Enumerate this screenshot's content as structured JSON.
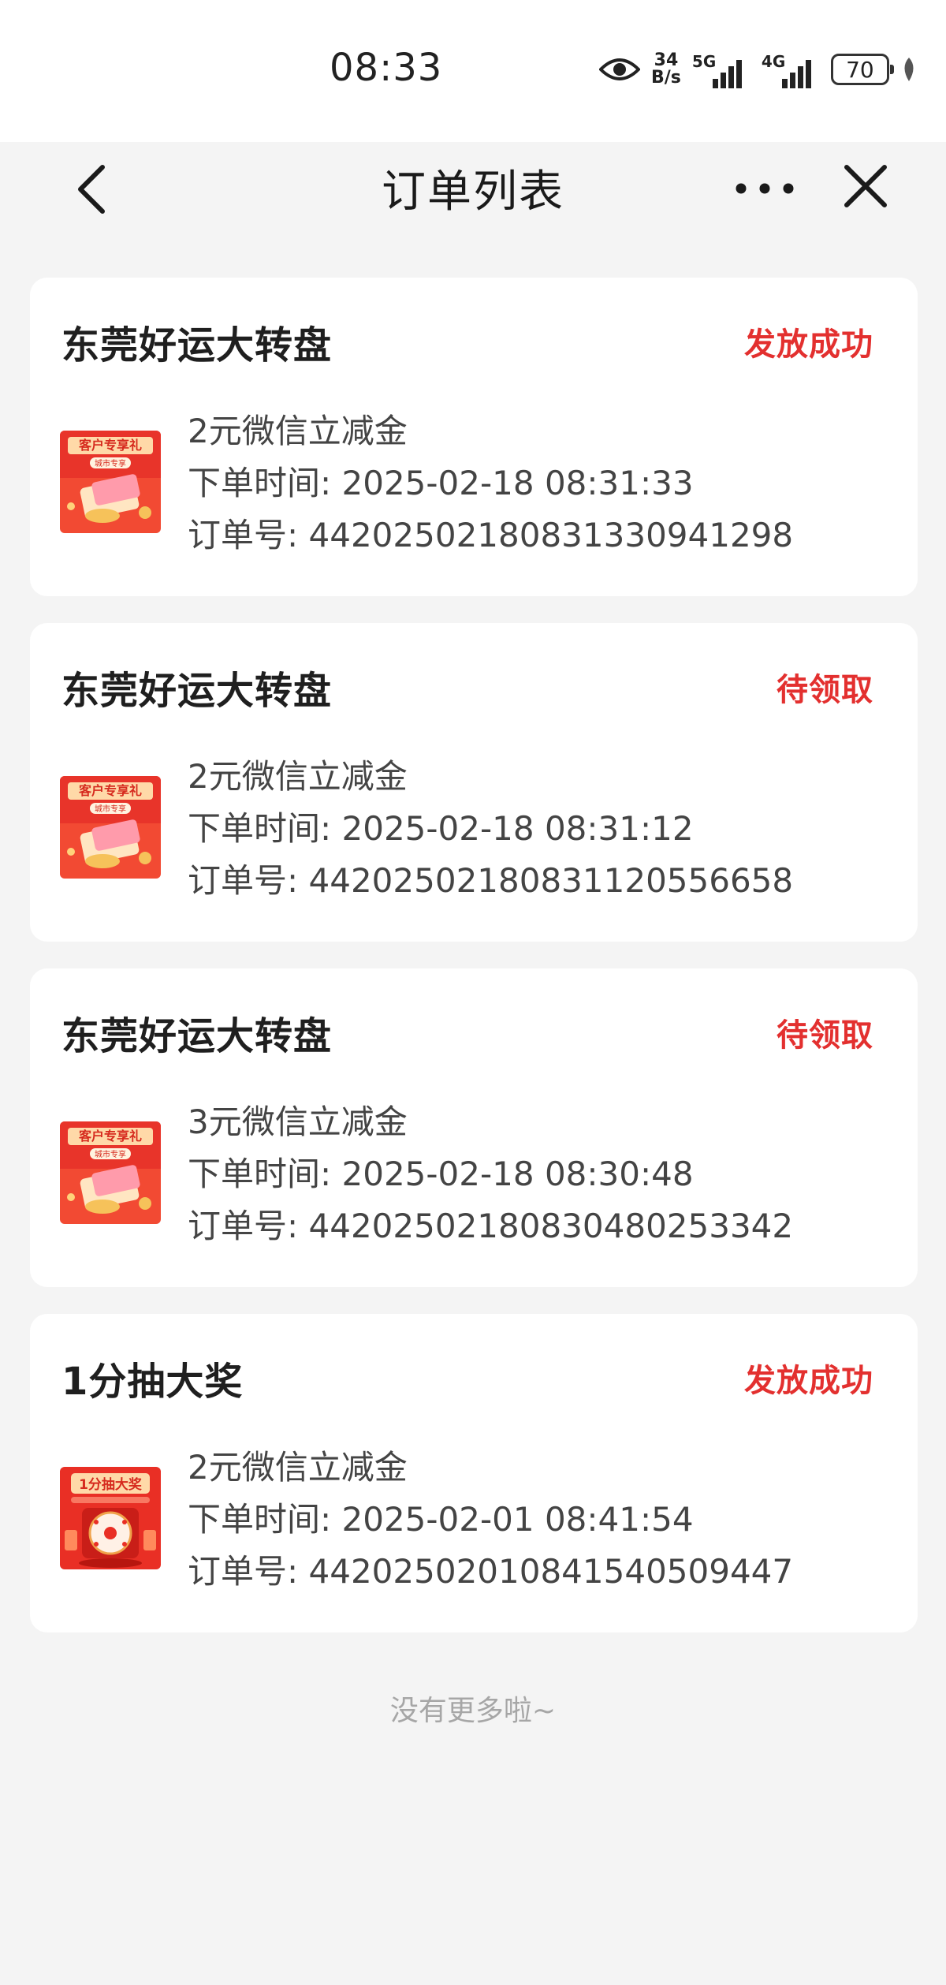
{
  "status_bar": {
    "time": "08:33",
    "net_speed_value": "34",
    "net_speed_unit": "B/s",
    "signal_1": "5G",
    "signal_2": "4G",
    "battery": "70",
    "icons": [
      "eye-icon",
      "signal-bars-icon",
      "signal-bars-icon",
      "battery-icon",
      "leaf-icon"
    ]
  },
  "nav": {
    "title": "订单列表",
    "icons": [
      "back-arrow-icon",
      "more-dots-icon",
      "close-icon"
    ]
  },
  "colors": {
    "accent_red": "#e3302f",
    "page_bg": "#f4f4f4",
    "card_bg": "#ffffff",
    "footer_text": "#a6a6a6"
  },
  "labels": {
    "time_prefix": "下单时间: ",
    "order_prefix": "订单号: "
  },
  "orders": [
    {
      "title": "东莞好运大转盘",
      "status": "发放成功",
      "product": "2元微信立减金",
      "time": "2025-02-18 08:31:33",
      "order_no": "442025021808313309 41298",
      "thumb_text": "客户专享礼",
      "thumb_sub": "城市专享"
    },
    {
      "title": "东莞好运大转盘",
      "status": "待领取",
      "product": "2元微信立减金",
      "time": "2025-02-18 08:31:12",
      "order_no": "4420250218083112055 6658",
      "thumb_text": "客户专享礼",
      "thumb_sub": "城市专享"
    },
    {
      "title": "东莞好运大转盘",
      "status": "待领取",
      "product": "3元微信立减金",
      "time": "2025-02-18 08:30:48",
      "order_no": "4420250218083048025 3342",
      "thumb_text": "客户专享礼",
      "thumb_sub": "城市专享"
    },
    {
      "title": "1分抽大奖",
      "status": "发放成功",
      "product": "2元微信立减金",
      "time": "2025-02-01 08:41:54",
      "order_no": "4420250201084154050 9447",
      "thumb_text": "1分抽大奖",
      "thumb_sub": ""
    }
  ],
  "footer": {
    "no_more": "没有更多啦~"
  }
}
